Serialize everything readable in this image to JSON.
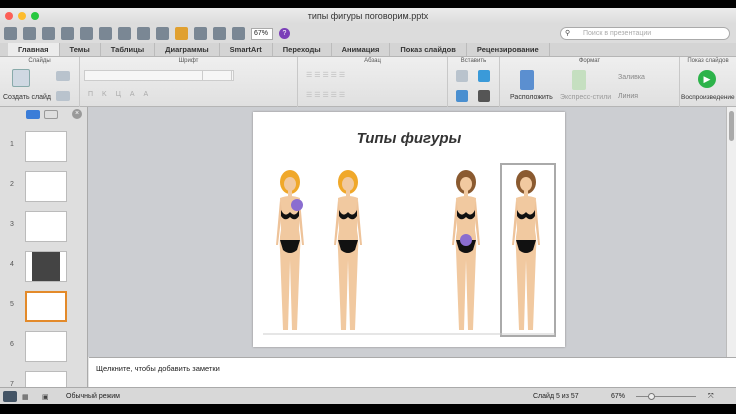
{
  "window": {
    "title": "типы фигуры поговорим.pptx"
  },
  "toolbar": {
    "zoom": "67%",
    "help": "?",
    "search_placeholder": "Поиск в презентации"
  },
  "tabs": [
    "Главная",
    "Темы",
    "Таблицы",
    "Диаграммы",
    "SmartArt",
    "Переходы",
    "Анимация",
    "Показ слайдов",
    "Рецензирование"
  ],
  "ribbon": {
    "groups": {
      "slides": "Слайды",
      "font": "Шрифт",
      "paragraph": "Абзац",
      "insert": "Вставить",
      "format": "Формат",
      "slideshow": "Показ слайдов"
    },
    "new_slide": "Создать слайд",
    "arrange": "Расположить",
    "quick_styles": "Экспресс-стили",
    "fill": "Заливка",
    "line": "Линия",
    "play": "Воспроизведение"
  },
  "slides_panel": {
    "numbers": [
      "1",
      "2",
      "3",
      "4",
      "5",
      "6",
      "7"
    ],
    "selected": 5
  },
  "slide": {
    "title": "Типы фигуры"
  },
  "notes": {
    "placeholder": "Щелкните, чтобы добавить заметки"
  },
  "status": {
    "view": "Обычный режим",
    "slide_counter": "Слайд 5 из 57",
    "zoom": "67%"
  },
  "colors": {
    "accent": "#e38a2a",
    "play": "#2db34a"
  }
}
